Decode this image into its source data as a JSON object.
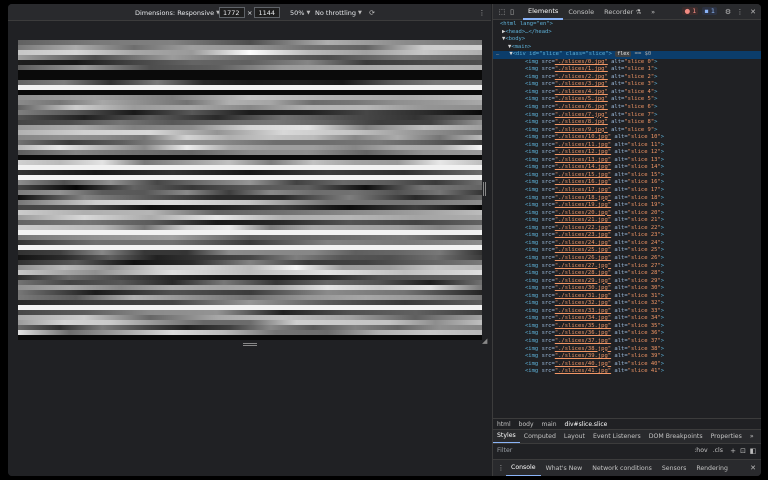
{
  "devbar": {
    "dimensions_label": "Dimensions: Responsive",
    "width_value": "1772",
    "times": "×",
    "height_value": "1144",
    "zoom": "50%",
    "throttling": "No throttling"
  },
  "viewport": {
    "slice_count": 60
  },
  "devtools": {
    "tabs": [
      "Elements",
      "Console",
      "Recorder"
    ],
    "error_count": "1",
    "message_count": "1",
    "more_tabs": "»"
  },
  "tree": {
    "html_open": "<html lang=\"en\">",
    "head": "<head>…</head>",
    "body": "<body>",
    "main": "<main>",
    "div_prefix": "<div id=\"slice\" class=\"slice\">",
    "flex_badge": "flex",
    "eq": "== $0",
    "img_lines": [
      "./slices/0.jpg|slice 0",
      "./slices/1.jpg|slice 1",
      "./slices/2.jpg|slice 2",
      "./slices/3.jpg|slice 3",
      "./slices/4.jpg|slice 4",
      "./slices/5.jpg|slice 5",
      "./slices/6.jpg|slice 6",
      "./slices/7.jpg|slice 7",
      "./slices/8.jpg|slice 8",
      "./slices/9.jpg|slice 9",
      "./slices/10.jpg|slice 10",
      "./slices/11.jpg|slice 11",
      "./slices/12.jpg|slice 12",
      "./slices/13.jpg|slice 13",
      "./slices/14.jpg|slice 14",
      "./slices/15.jpg|slice 15",
      "./slices/16.jpg|slice 16",
      "./slices/17.jpg|slice 17",
      "./slices/18.jpg|slice 18",
      "./slices/19.jpg|slice 19",
      "./slices/20.jpg|slice 20",
      "./slices/21.jpg|slice 21",
      "./slices/22.jpg|slice 22",
      "./slices/23.jpg|slice 23",
      "./slices/24.jpg|slice 24",
      "./slices/25.jpg|slice 25",
      "./slices/26.jpg|slice 26",
      "./slices/27.jpg|slice 27",
      "./slices/28.jpg|slice 28",
      "./slices/29.jpg|slice 29",
      "./slices/30.jpg|slice 30",
      "./slices/31.jpg|slice 31",
      "./slices/32.jpg|slice 32",
      "./slices/33.jpg|slice 33",
      "./slices/34.jpg|slice 34",
      "./slices/35.jpg|slice 35",
      "./slices/36.jpg|slice 36",
      "./slices/37.jpg|slice 37",
      "./slices/38.jpg|slice 38",
      "./slices/39.jpg|slice 39",
      "./slices/40.jpg|slice 40",
      "./slices/41.jpg|slice 41"
    ]
  },
  "breadcrumbs": [
    "html",
    "body",
    "main",
    "div#slice.slice"
  ],
  "style_tabs": [
    "Styles",
    "Computed",
    "Layout",
    "Event Listeners",
    "DOM Breakpoints",
    "Properties",
    "»"
  ],
  "filter": {
    "placeholder": "Filter",
    "hov": ":hov",
    "cls": ".cls"
  },
  "drawer_tabs": [
    "Console",
    "What's New",
    "Network conditions",
    "Sensors",
    "Rendering"
  ]
}
